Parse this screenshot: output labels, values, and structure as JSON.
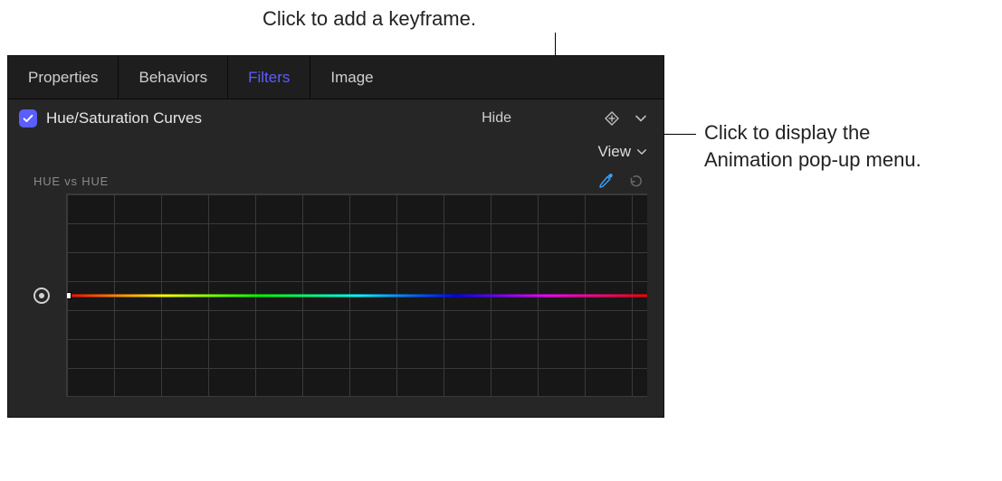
{
  "annotations": {
    "keyframe": "Click to add a keyframe.",
    "anim_menu_line1": "Click to display the",
    "anim_menu_line2": "Animation pop-up menu."
  },
  "tabs": {
    "properties": "Properties",
    "behaviors": "Behaviors",
    "filters": "Filters",
    "image": "Image"
  },
  "filter": {
    "title": "Hue/Saturation Curves",
    "hide": "Hide",
    "view": "View",
    "curve_label": "HUE vs HUE"
  }
}
